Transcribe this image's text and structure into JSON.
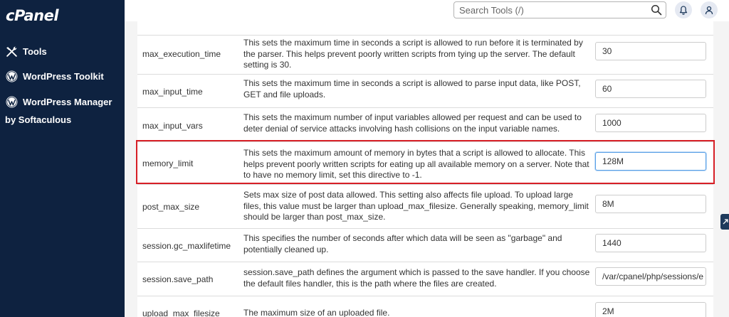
{
  "sidebar": {
    "logo": "cPanel",
    "items": [
      {
        "label": "Tools",
        "icon": "tools-icon"
      },
      {
        "label": "WordPress Toolkit",
        "icon": "wordpress-icon"
      },
      {
        "label": "WordPress Manager",
        "sublabel": "by Softaculous",
        "icon": "wordpress-icon"
      }
    ]
  },
  "header": {
    "search_placeholder": "Search Tools (/)"
  },
  "directives": [
    {
      "name": "max_execution_time",
      "description": "This sets the maximum time in seconds a script is allowed to run before it is terminated by the parser. This helps prevent poorly written scripts from tying up the server. The default setting is 30.",
      "value": "30"
    },
    {
      "name": "max_input_time",
      "description": "This sets the maximum time in seconds a script is allowed to parse input data, like POST, GET and file uploads.",
      "value": "60"
    },
    {
      "name": "max_input_vars",
      "description": "This sets the maximum number of input variables allowed per request and can be used to deter denial of service attacks involving hash collisions on the input variable names.",
      "value": "1000"
    },
    {
      "name": "memory_limit",
      "description": "This sets the maximum amount of memory in bytes that a script is allowed to allocate. This helps prevent poorly written scripts for eating up all available memory on a server. Note that to have no memory limit, set this directive to -1.",
      "value": "128M",
      "highlighted": true
    },
    {
      "name": "post_max_size",
      "description": "Sets max size of post data allowed. This setting also affects file upload. To upload large files, this value must be larger than upload_max_filesize. Generally speaking, memory_limit should be larger than post_max_size.",
      "value": "8M"
    },
    {
      "name": "session.gc_maxlifetime",
      "description": "This specifies the number of seconds after which data will be seen as \"garbage\" and potentially cleaned up.",
      "value": "1440"
    },
    {
      "name": "session.save_path",
      "description": "session.save_path defines the argument which is passed to the save handler. If you choose the default files handler, this is the path where the files are created.",
      "value": "/var/cpanel/php/sessions/e"
    },
    {
      "name": "upload_max_filesize",
      "description": "The maximum size of an uploaded file.",
      "value": "2M"
    }
  ],
  "colors": {
    "sidebar_bg": "#0e2240",
    "highlight_border": "#d71f26",
    "focus_border": "#5aa0e6"
  }
}
